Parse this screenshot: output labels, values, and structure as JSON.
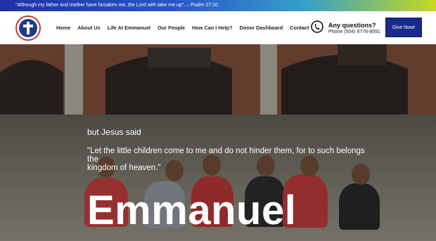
{
  "topbar": {
    "quote": "\"Although my father and mother have forsaken me, the Lord with take me up\". –  Psalm 27:10"
  },
  "nav": {
    "items": [
      "Home",
      "About Us",
      "Life At Emmanuel",
      "Our People",
      "How Can I Help?",
      "Donor Dashboard",
      "Contact"
    ]
  },
  "contact": {
    "title": "Any questions?",
    "phone": "Phone (504) 8778-8591"
  },
  "give_button": {
    "label": "Give Now!"
  },
  "hero": {
    "intro": "but Jesus said",
    "quote_line1": "\"Let the little children come to me and do not hinder them, for to such belongs",
    "quote_line2": "the",
    "quote_line3": "kingdom of heaven.\"",
    "title": "Emmanuel"
  },
  "colors": {
    "brand_blue": "#1a2a8a",
    "topbar_start": "#1f2fa8",
    "topbar_end": "#c8d820",
    "logo_red": "#c23a2e"
  }
}
